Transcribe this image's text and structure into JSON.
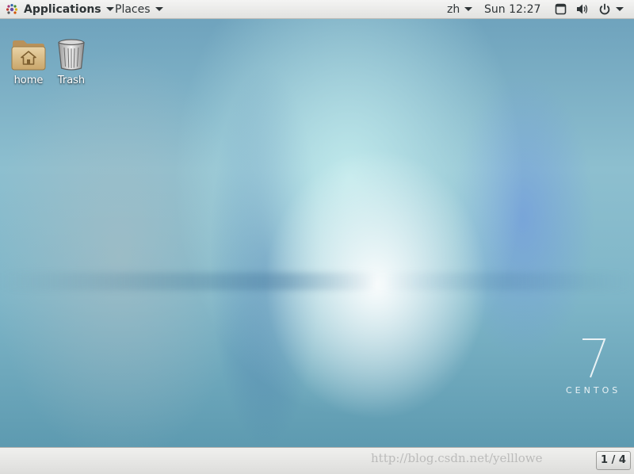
{
  "top_panel": {
    "applications_label": "Applications",
    "places_label": "Places",
    "language": "zh",
    "clock": "Sun 12:27",
    "icons": [
      "gnome-foot-icon",
      "window-icon",
      "volume-icon",
      "power-icon"
    ]
  },
  "desktop": {
    "icons": [
      {
        "label": "home",
        "icon": "home-folder-icon"
      },
      {
        "label": "Trash",
        "icon": "trash-icon"
      }
    ],
    "brand": {
      "number": "7",
      "word": "CENTOS"
    }
  },
  "bottom_panel": {
    "watermark": "http://blog.csdn.net/yelllowe",
    "workspace": "1 / 4"
  },
  "colors": {
    "panel_bg": "#e8e8e6",
    "panel_text": "#2e3436",
    "desktop_accent": "#7fb3c6"
  }
}
